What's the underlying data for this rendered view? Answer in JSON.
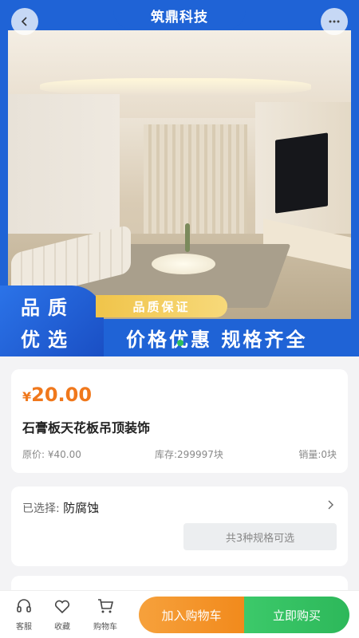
{
  "header": {
    "shop_name": "筑鼎科技",
    "back_icon": "back-icon",
    "more_icon": "more-icon"
  },
  "banner": {
    "promo_line1": "品质",
    "promo_line2": "优选",
    "badge": "品质保证",
    "slogan": "价格优惠 规格齐全",
    "accent_color": "#1f63d6"
  },
  "product": {
    "currency": "¥",
    "price": "20.00",
    "title": "石膏板天花板吊顶装饰",
    "original_price": "原价: ¥40.00",
    "stock": "库存:299997块",
    "sales": "销量:0块",
    "price_color": "#f0781c"
  },
  "spec": {
    "label": "已选择: ",
    "value": "防腐蚀",
    "options_button": "共3种规格可选"
  },
  "bottom_bar": {
    "service_label": "客服",
    "favorite_label": "收藏",
    "cart_label": "购物车",
    "add_to_cart": "加入购物车",
    "buy_now": "立即购买",
    "cart_color": "#f28a1c",
    "buy_color": "#2db85a"
  }
}
